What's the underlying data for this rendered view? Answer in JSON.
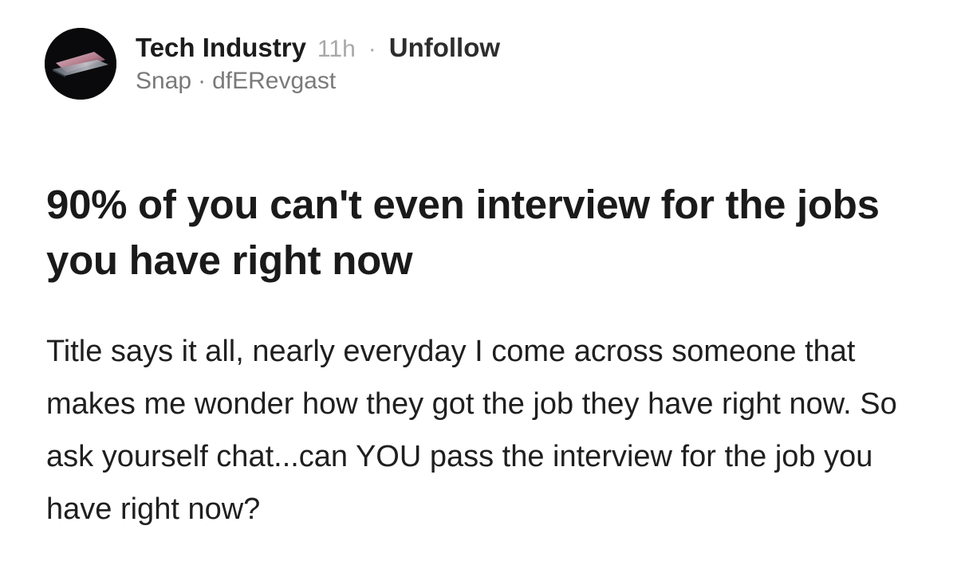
{
  "post": {
    "community": "Tech Industry",
    "time_ago": "11h",
    "separator": "·",
    "follow_action": "Unfollow",
    "company": "Snap",
    "author": "dfERevgast",
    "title": "90% of you can't even interview for the jobs you have right now",
    "body": "Title says it all, nearly everyday I come across someone that makes me wonder how they got the job they have right now. So ask yourself chat...can YOU pass the interview for the job you have right now?"
  },
  "avatar": {
    "icon": "laptop-icon",
    "background_color": "#0a0a0c",
    "accent_color": "#e8a4b8"
  }
}
